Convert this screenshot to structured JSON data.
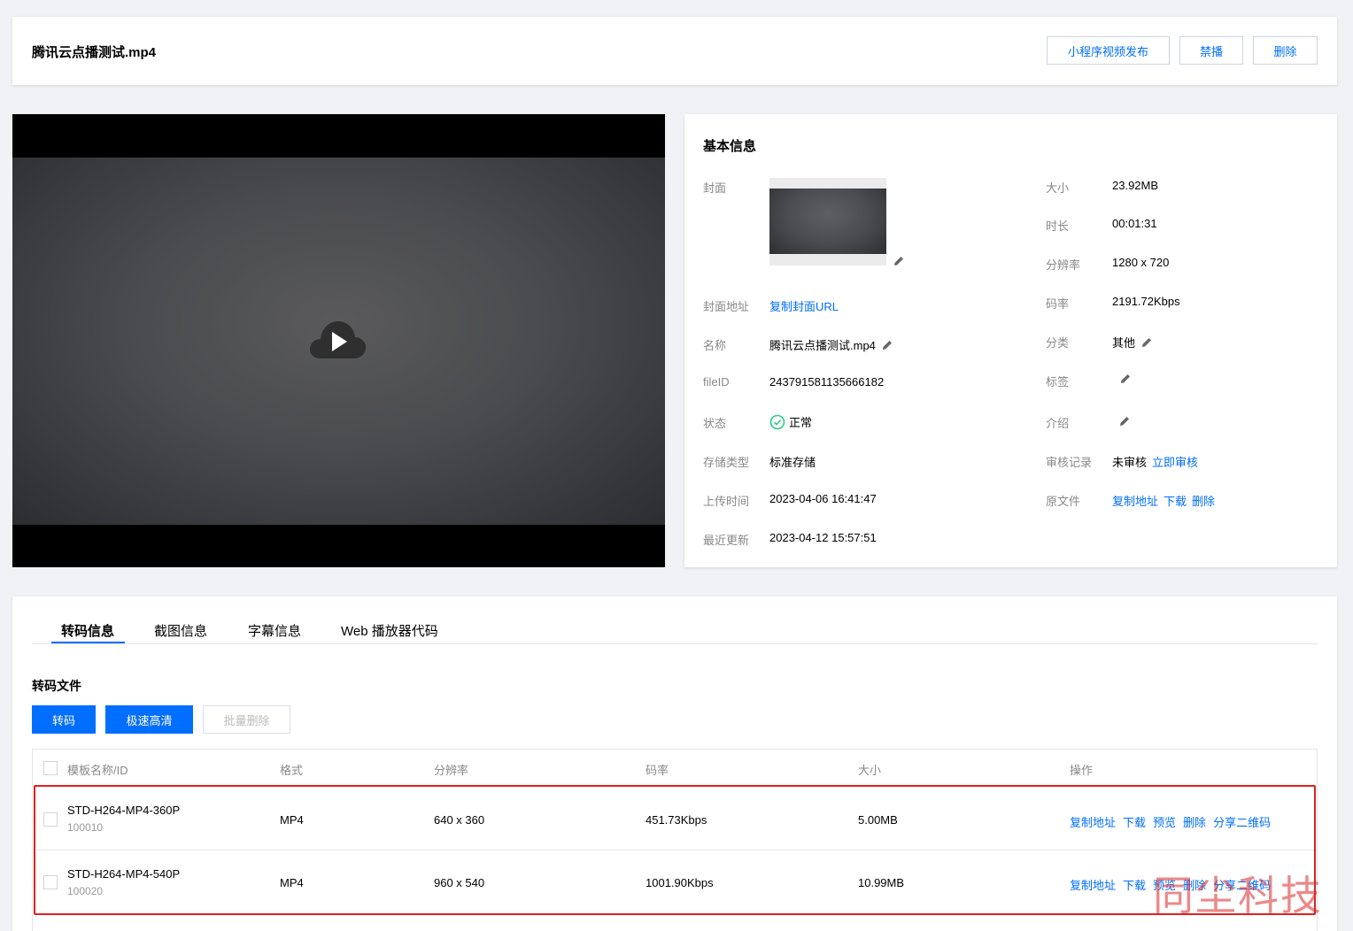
{
  "header": {
    "title": "腾讯云点播测试.mp4",
    "publish_label": "小程序视频发布",
    "ban_label": "禁播",
    "delete_label": "删除"
  },
  "info": {
    "section_title": "基本信息",
    "cover_label": "封面",
    "cover_url_label": "封面地址",
    "cover_url_action": "复制封面URL",
    "name_label": "名称",
    "name_value": "腾讯云点播测试.mp4",
    "fileid_label": "fileID",
    "fileid_value": "243791581135666182",
    "status_label": "状态",
    "status_value": "正常",
    "storage_label": "存储类型",
    "storage_value": "标准存储",
    "upload_label": "上传时间",
    "upload_value": "2023-04-06 16:41:47",
    "updated_label": "最近更新",
    "updated_value": "2023-04-12 15:57:51",
    "size_label": "大小",
    "size_value": "23.92MB",
    "duration_label": "时长",
    "duration_value": "00:01:31",
    "resolution_label": "分辨率",
    "resolution_value": "1280 x 720",
    "bitrate_label": "码率",
    "bitrate_value": "2191.72Kbps",
    "category_label": "分类",
    "category_value": "其他",
    "tag_label": "标签",
    "intro_label": "介绍",
    "review_label": "审核记录",
    "review_value": "未审核",
    "review_action": "立即审核",
    "source_label": "原文件",
    "source_copy": "复制地址",
    "source_download": "下载",
    "source_delete": "删除"
  },
  "tabs": [
    {
      "label": "转码信息"
    },
    {
      "label": "截图信息"
    },
    {
      "label": "字幕信息"
    },
    {
      "label": "Web 播放器代码"
    }
  ],
  "transcode": {
    "title": "转码文件",
    "btn_transcode": "转码",
    "btn_hd": "极速高清",
    "btn_batch_delete": "批量删除",
    "columns": [
      "模板名称/ID",
      "格式",
      "分辨率",
      "码率",
      "大小",
      "操作"
    ],
    "rows": [
      {
        "name": "STD-H264-MP4-360P",
        "id": "100010",
        "format": "MP4",
        "resolution": "640 x 360",
        "bitrate": "451.73Kbps",
        "size": "5.00MB"
      },
      {
        "name": "STD-H264-MP4-540P",
        "id": "100020",
        "format": "MP4",
        "resolution": "960 x 540",
        "bitrate": "1001.90Kbps",
        "size": "10.99MB"
      }
    ],
    "ops": [
      "复制地址",
      "下载",
      "预览",
      "删除",
      "分享二维码"
    ]
  },
  "watermark": "同尘科技",
  "colors": {
    "accent": "#006eff",
    "highlight_border": "#e02020",
    "success": "#29cc85"
  }
}
